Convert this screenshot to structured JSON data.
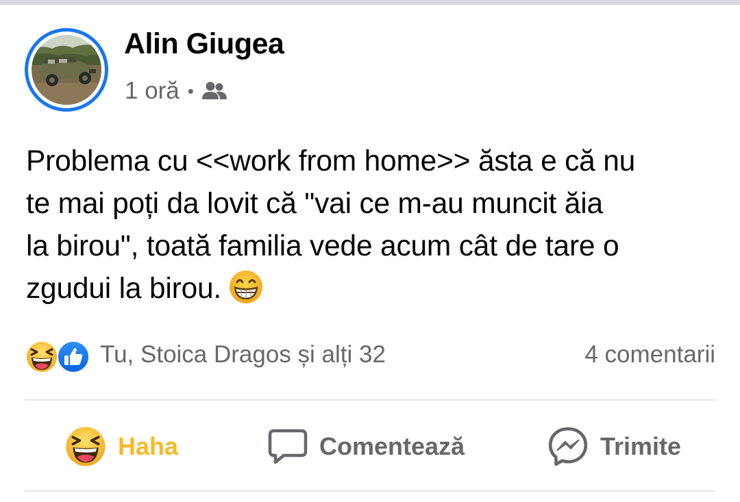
{
  "post": {
    "author": "Alin Giugea",
    "time": "1 oră",
    "separator": "•",
    "audience_icon": "friends-icon",
    "text_lines": [
      "Problema cu <<work from home>> ăsta e că nu",
      "te mai poți da lovit că \"vai ce m-au muncit ăia",
      "la birou\", toată familia vede acum cât de tare o",
      "zgudui la birou."
    ],
    "text_emoji": "grinning-face-icon"
  },
  "reactions": {
    "icons": [
      "haha-reaction-icon",
      "like-reaction-icon"
    ],
    "summary": "Tu, Stoica Dragos și alți 32",
    "comments": "4 comentarii"
  },
  "actions": {
    "haha_label": "Haha",
    "comment_label": "Comentează",
    "send_label": "Trimite"
  },
  "colors": {
    "primary_text": "#050505",
    "secondary_text": "#65676b",
    "story_ring": "#1877f2",
    "haha_active": "#f7b928",
    "divider": "#e4e6eb"
  }
}
